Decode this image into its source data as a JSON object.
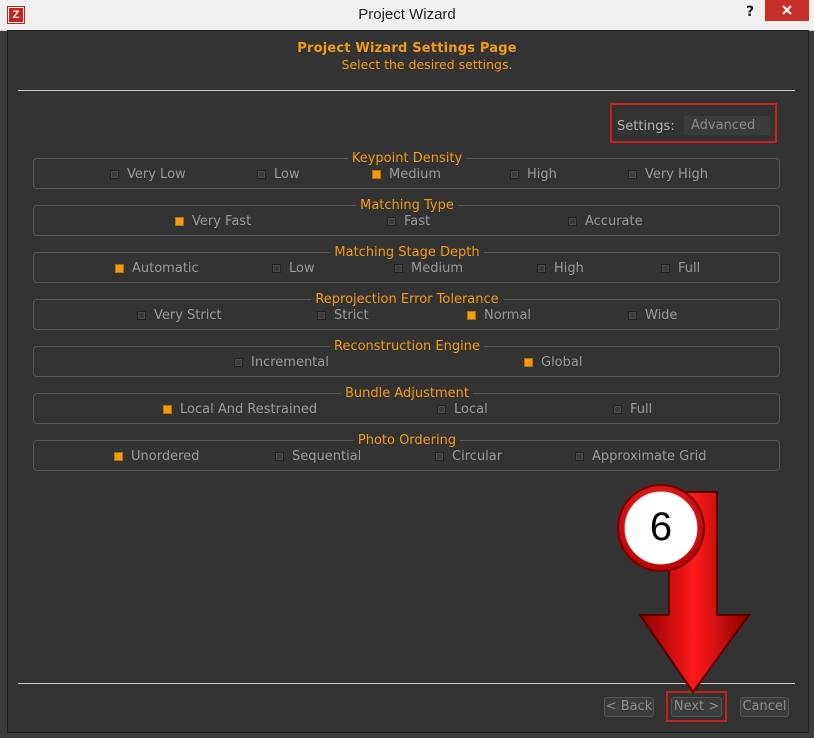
{
  "window": {
    "app_icon_letter": "Z",
    "title": "Project Wizard",
    "help_label": "?",
    "close_label": "x"
  },
  "header": {
    "title": "Project Wizard Settings Page",
    "subtitle": "Select the desired settings."
  },
  "settings": {
    "label": "Settings:",
    "value": "Advanced"
  },
  "groups": [
    {
      "title": "Keypoint Density",
      "options": [
        {
          "label": "Very Low",
          "checked": false
        },
        {
          "label": "Low",
          "checked": false
        },
        {
          "label": "Medium",
          "checked": true
        },
        {
          "label": "High",
          "checked": false
        },
        {
          "label": "Very High",
          "checked": false
        }
      ]
    },
    {
      "title": "Matching Type",
      "options": [
        {
          "label": "Very Fast",
          "checked": true
        },
        {
          "label": "Fast",
          "checked": false
        },
        {
          "label": "Accurate",
          "checked": false
        }
      ]
    },
    {
      "title": "Matching Stage Depth",
      "options": [
        {
          "label": "Automatic",
          "checked": true
        },
        {
          "label": "Low",
          "checked": false
        },
        {
          "label": "Medium",
          "checked": false
        },
        {
          "label": "High",
          "checked": false
        },
        {
          "label": "Full",
          "checked": false
        }
      ]
    },
    {
      "title": "Reprojection Error Tolerance",
      "options": [
        {
          "label": "Very Strict",
          "checked": false
        },
        {
          "label": "Strict",
          "checked": false
        },
        {
          "label": "Normal",
          "checked": true
        },
        {
          "label": "Wide",
          "checked": false
        }
      ]
    },
    {
      "title": "Reconstruction Engine",
      "options": [
        {
          "label": "Incremental",
          "checked": false
        },
        {
          "label": "Global",
          "checked": true
        }
      ]
    },
    {
      "title": "Bundle Adjustment",
      "options": [
        {
          "label": "Local And Restrained",
          "checked": true
        },
        {
          "label": "Local",
          "checked": false
        },
        {
          "label": "Full",
          "checked": false
        }
      ]
    },
    {
      "title": "Photo Ordering",
      "options": [
        {
          "label": "Unordered",
          "checked": true
        },
        {
          "label": "Sequential",
          "checked": false
        },
        {
          "label": "Circular",
          "checked": false
        },
        {
          "label": "Approximate Grid",
          "checked": false
        }
      ]
    }
  ],
  "footer": {
    "back_label": "< Back",
    "next_label": "Next >",
    "cancel_label": "Cancel"
  },
  "annotation": {
    "step_number": "6",
    "arrow_icon": "down-arrow-icon",
    "accent_color": "#e00000"
  }
}
